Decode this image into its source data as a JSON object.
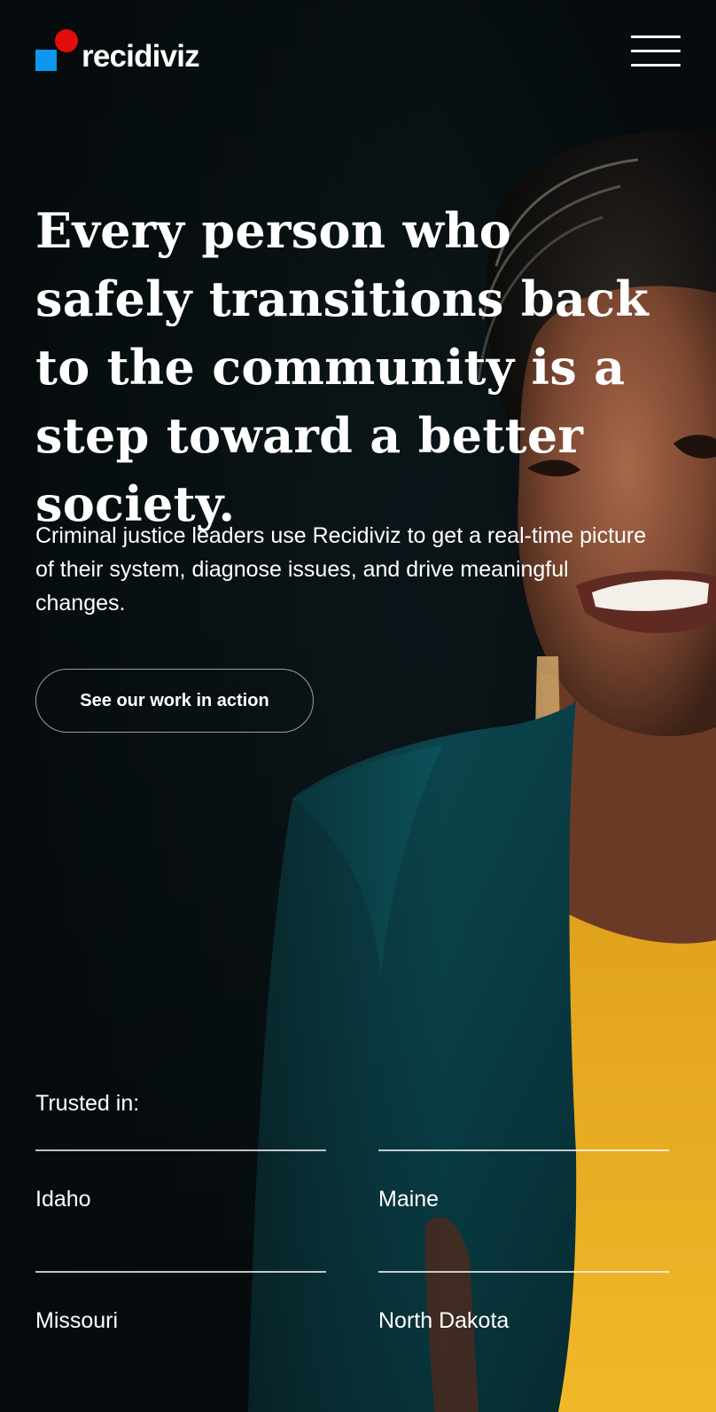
{
  "header": {
    "logo_text": "recidiviz",
    "menu_icon": "hamburger-menu-icon"
  },
  "hero": {
    "headline": "Every person who safely transitions back to the community is a step toward a better society.",
    "subtext": "Criminal justice leaders use Recidiviz to get a real-time picture of their system, diagnose issues, and drive meaningful changes.",
    "cta_label": "See our work in action"
  },
  "trusted": {
    "label": "Trusted in:",
    "states": [
      "Idaho",
      "Maine",
      "Missouri",
      "North Dakota"
    ]
  },
  "colors": {
    "logo_square": "#0d97f0",
    "logo_dot": "#e30c0c",
    "background": "#060c0e",
    "text": "#ffffff"
  }
}
